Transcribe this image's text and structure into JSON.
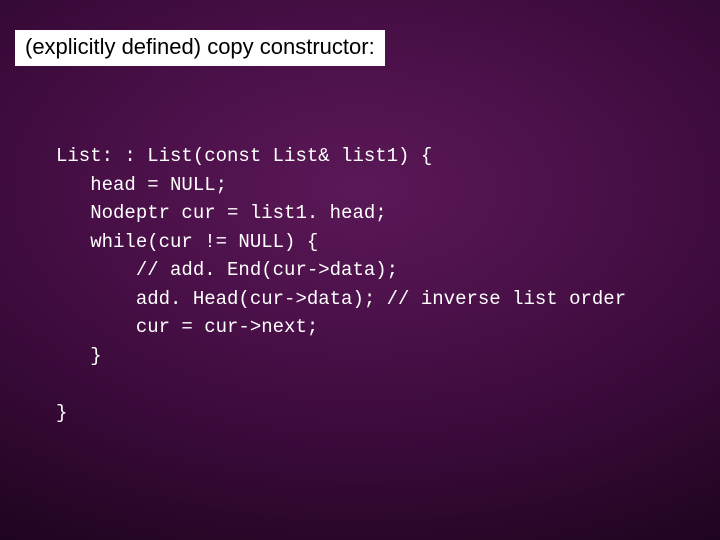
{
  "title": "(explicitly defined) copy constructor:",
  "code": {
    "l1": "List: : List(const List& list1) {",
    "l2": "   head = NULL;",
    "l3": "   Nodeptr cur = list1. head;",
    "l4": "   while(cur != NULL) {",
    "l5": "       // add. End(cur->data);",
    "l6": "       add. Head(cur->data); // inverse list order",
    "l7": "       cur = cur->next;",
    "l8": "   }",
    "l9": "",
    "l10": "}"
  }
}
